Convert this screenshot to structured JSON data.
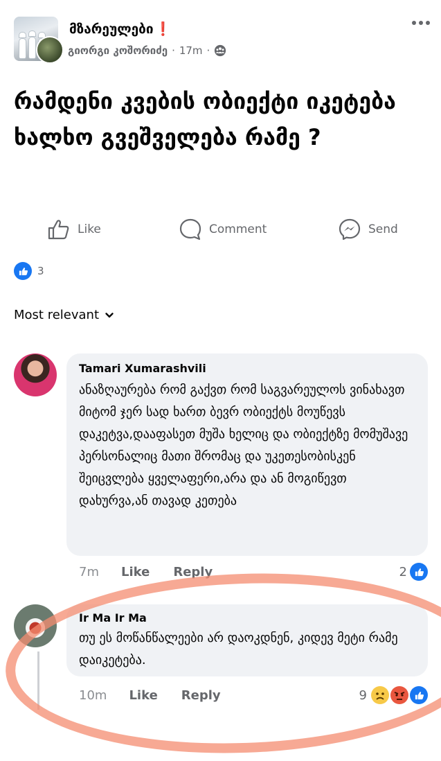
{
  "header": {
    "group_name": "მზარეულები",
    "warning_mark": "❗",
    "poster_name": "გიორგი კოშორიძე",
    "separator": "·",
    "time": "17m",
    "separator2": "·"
  },
  "post": {
    "text": "რამდენი კვების ობიექტი იკეტება ხალხო გვეშველება რამე ?"
  },
  "actions": {
    "like": "Like",
    "comment": "Comment",
    "send": "Send"
  },
  "reactions": {
    "count": "3"
  },
  "sort": {
    "label": "Most relevant"
  },
  "comments": [
    {
      "author": "Tamari Xumarashvili",
      "text": "ანაზღაურება რომ გაქვთ რომ საგვარეულოს ვინახავთ მიტომ ჯერ სად ხართ ბევრ ობიექტს მოუწევს დაკეტვა,დააფასეთ მუშა ხელიც და ობიექტზე მომუშავე პერსონალიც მათი შრომაც და უკეთესობისკენ შეიცვლება ყველაფერი,არა და ან მოგიწევთ დახურვა,ან თავად კეთება",
      "time": "7m",
      "like": "Like",
      "reply": "Reply",
      "reaction_count": "2"
    },
    {
      "author": "Ir Ma Ir Ma",
      "text": "თუ ეს მოწანწალეები  არ დაოკდნენ, კიდევ მეტი რამე დაიკეტება.",
      "time": "10m",
      "like": "Like",
      "reply": "Reply",
      "reaction_count": "9"
    }
  ],
  "colors": {
    "accent": "#1877f2",
    "secondary_text": "#65676b",
    "bubble": "#f0f2f5",
    "highlight": "#f48c70"
  }
}
